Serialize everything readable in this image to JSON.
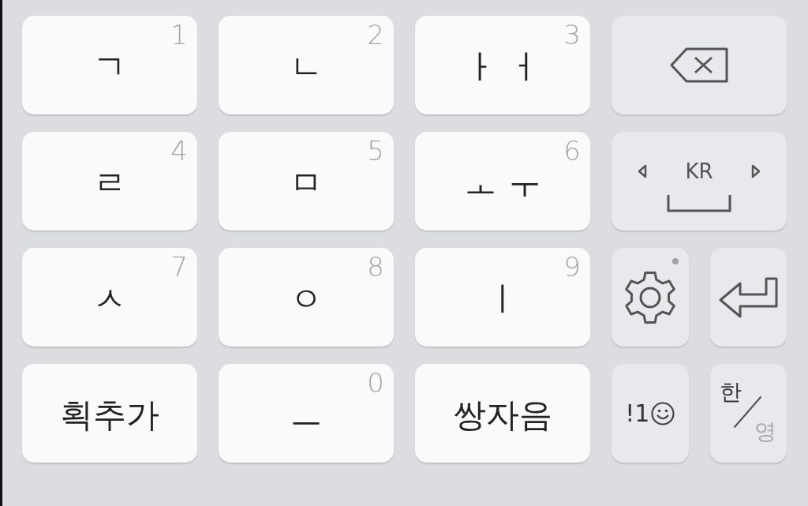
{
  "keyboard": {
    "rows": [
      {
        "keys": [
          {
            "kind": "letter",
            "label": "ㄱ",
            "hint": "1"
          },
          {
            "kind": "letter",
            "label": "ㄴ",
            "hint": "2"
          },
          {
            "kind": "letter",
            "label": "ㅏ ㅓ",
            "hint": "3"
          },
          {
            "kind": "backspace"
          }
        ]
      },
      {
        "keys": [
          {
            "kind": "letter",
            "label": "ㄹ",
            "hint": "4"
          },
          {
            "kind": "letter",
            "label": "ㅁ",
            "hint": "5"
          },
          {
            "kind": "letter",
            "label": "ㅗ ㅜ",
            "hint": "6"
          },
          {
            "kind": "space",
            "label": "KR"
          }
        ]
      },
      {
        "keys": [
          {
            "kind": "letter",
            "label": "ㅅ",
            "hint": "7"
          },
          {
            "kind": "letter",
            "label": "ㅇ",
            "hint": "8"
          },
          {
            "kind": "letter",
            "label": "ㅣ",
            "hint": "9"
          },
          {
            "kind": "settings",
            "notification": true
          },
          {
            "kind": "enter"
          }
        ]
      },
      {
        "keys": [
          {
            "kind": "letter",
            "label": "획추가"
          },
          {
            "kind": "letter",
            "label": "ㅡ",
            "hint": "0"
          },
          {
            "kind": "letter",
            "label": "쌍자음"
          },
          {
            "kind": "symbols",
            "label": "!1"
          },
          {
            "kind": "language",
            "options": [
              {
                "label": "한",
                "selected": true
              },
              {
                "label": "영",
                "selected": false
              }
            ]
          }
        ]
      }
    ]
  }
}
